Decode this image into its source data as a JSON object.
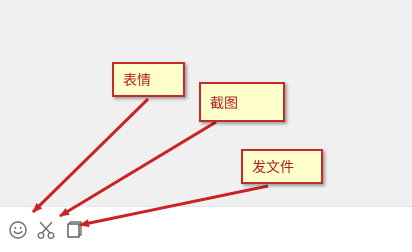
{
  "annotations": {
    "emoji": "表情",
    "screenshot": "截图",
    "send_file": "发文件"
  },
  "toolbar": {
    "icons": [
      "smiley-icon",
      "scissors-icon",
      "file-icon"
    ]
  },
  "colors": {
    "background": "#f0f0f0",
    "toolbar": "#ffffff",
    "callout_fill": "#ffffcc",
    "callout_border": "#c42a2a",
    "callout_text": "#b21c1c",
    "arrow": "#cc2222",
    "icon": "#6e6e6e"
  }
}
